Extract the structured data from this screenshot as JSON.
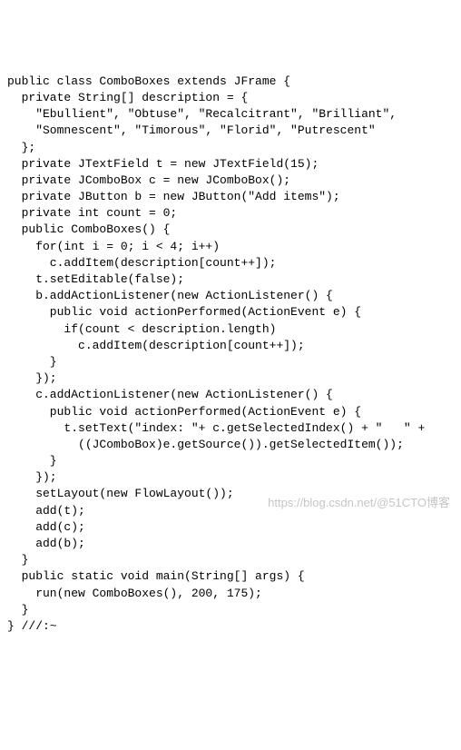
{
  "code": {
    "lines": [
      "public class ComboBoxes extends JFrame {",
      "  private String[] description = {",
      "    \"Ebullient\", \"Obtuse\", \"Recalcitrant\", \"Brilliant\",",
      "    \"Somnescent\", \"Timorous\", \"Florid\", \"Putrescent\"",
      "  };",
      "  private JTextField t = new JTextField(15);",
      "  private JComboBox c = new JComboBox();",
      "  private JButton b = new JButton(\"Add items\");",
      "  private int count = 0;",
      "  public ComboBoxes() {",
      "    for(int i = 0; i < 4; i++)",
      "      c.addItem(description[count++]);",
      "    t.setEditable(false);",
      "    b.addActionListener(new ActionListener() {",
      "      public void actionPerformed(ActionEvent e) {",
      "        if(count < description.length)",
      "          c.addItem(description[count++]);",
      "      }",
      "    });",
      "    c.addActionListener(new ActionListener() {",
      "      public void actionPerformed(ActionEvent e) {",
      "        t.setText(\"index: \"+ c.getSelectedIndex() + \"   \" +",
      "          ((JComboBox)e.getSource()).getSelectedItem());",
      "      }",
      "    });",
      "    setLayout(new FlowLayout());",
      "    add(t);",
      "    add(c);",
      "    add(b);",
      "  }",
      "  public static void main(String[] args) {",
      "    run(new ComboBoxes(), 200, 175);",
      "  }",
      "} ///:~"
    ]
  },
  "watermark": {
    "left": "https://blog.csdn.net/",
    "right": "@51CTO博客"
  }
}
